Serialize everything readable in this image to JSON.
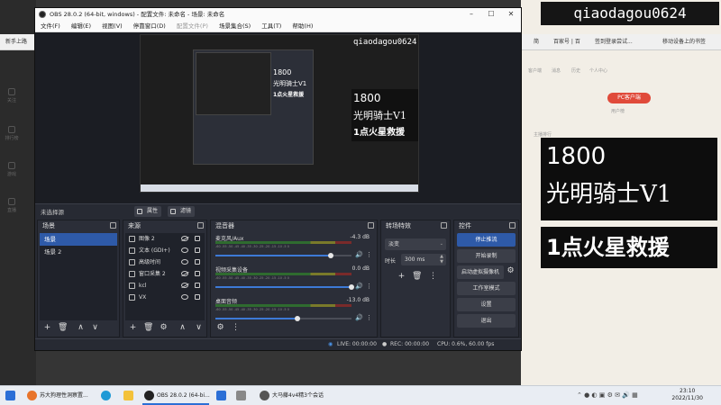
{
  "watermark": "qiaodagou0624",
  "overlay": {
    "line1": "1800",
    "line2": "光明骑士V1",
    "line3": "1点火星救援"
  },
  "browser": {
    "bookmark_left": "新手上路",
    "bookmarks_right": [
      "简",
      "百家号 | 百",
      "签到登录尝试...",
      "移动设备上的书签"
    ],
    "pc_badge": "PC客户端",
    "side_labels": [
      "关注",
      "排行榜",
      "游戏",
      "直播"
    ],
    "bg_texts": [
      "客户端",
      "消息",
      "历史",
      "个人中心",
      "主播排行",
      "用户榜"
    ]
  },
  "obs": {
    "title": "OBS 28.0.2 (64-bit, windows) - 配置文件: 未命名 - 场景: 未命名",
    "menu": [
      "文件(F)",
      "编辑(E)",
      "视图(V)",
      "停靠窗口(D)",
      "配置文件(P)",
      "场景集合(S)",
      "工具(T)",
      "帮助(H)"
    ],
    "preview_watermark": "qiaodagou0624",
    "source_bar": {
      "no_source": "未选择源",
      "properties": "属性",
      "filters": "滤镜"
    },
    "scenes": {
      "title": "场景",
      "items": [
        "场景",
        "场景 2"
      ]
    },
    "sources": {
      "title": "来源",
      "items": [
        {
          "name": "图像 2",
          "visible": false
        },
        {
          "name": "文本 (GDI+)",
          "visible": true
        },
        {
          "name": "高级时间",
          "visible": true
        },
        {
          "name": "窗口采集 2",
          "visible": false
        },
        {
          "name": "kcl",
          "visible": false
        },
        {
          "name": "VX",
          "visible": true
        }
      ]
    },
    "mixer": {
      "title": "混音器",
      "channels": [
        {
          "name": "麦克风/Aux",
          "db": "-4.3 dB",
          "volume": 0.85
        },
        {
          "name": "视频采集设备",
          "db": "0.0 dB",
          "volume": 1.0
        },
        {
          "name": "桌面音频",
          "db": "-13.0 dB",
          "volume": 0.6
        }
      ],
      "ticks": "-60 -55 -50 -45 -40 -35 -30 -25 -20 -15 -10 -5 0"
    },
    "transitions": {
      "title": "转场特效",
      "selected": "淡变",
      "duration_label": "时长",
      "duration": "300 ms"
    },
    "controls": {
      "title": "控件",
      "buttons": [
        "停止推流",
        "开始录制",
        "启动虚拟摄像机",
        "工作室模式",
        "设置",
        "退出"
      ]
    },
    "status": {
      "live": "LIVE: 00:00:00",
      "rec": "REC: 00:00:00",
      "cpu": "CPU: 0.6%, 60.00 fps"
    }
  },
  "taskbar": {
    "items": [
      "苏大狗理性洞察置...",
      "OBS 28.0.2 (64-bi...",
      "大马藤4v4精3个会话"
    ],
    "time": "23:10",
    "date": "2022/11/30"
  },
  "colors": {
    "obs_bg": "#272a33",
    "accent": "#2e5aa8",
    "taskbar": "#e9edf3"
  }
}
